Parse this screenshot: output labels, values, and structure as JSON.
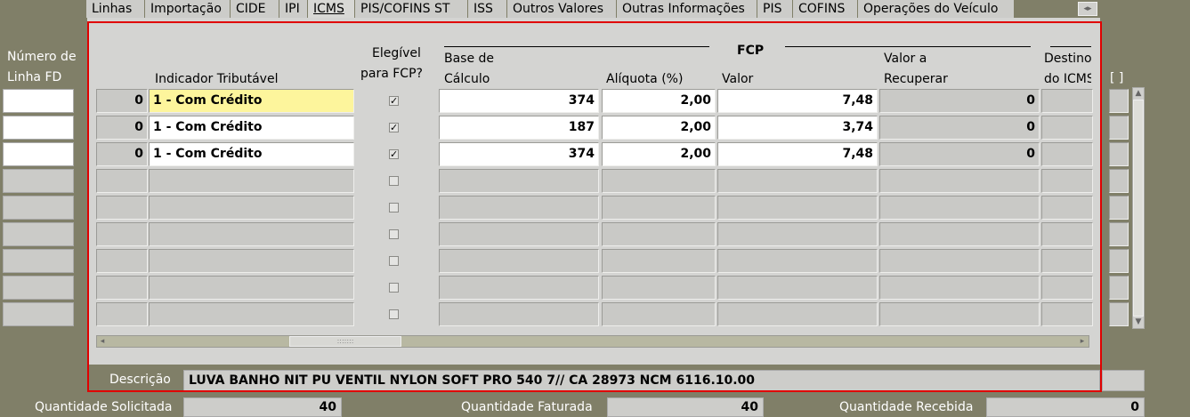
{
  "tabs": [
    {
      "label": "Linhas",
      "w": 66
    },
    {
      "label": "Importação",
      "w": 96
    },
    {
      "label": "CIDE",
      "w": 55
    },
    {
      "label": "IPI",
      "w": 32
    },
    {
      "label": "ICMS",
      "w": 53,
      "active": true
    },
    {
      "label": "PIS/COFINS ST",
      "w": 127
    },
    {
      "label": "ISS",
      "w": 44
    },
    {
      "label": "Outros Valores",
      "w": 123
    },
    {
      "label": "Outras Informações",
      "w": 158
    },
    {
      "label": "PIS",
      "w": 40
    },
    {
      "label": "COFINS",
      "w": 73
    },
    {
      "label": "Operações do Veículo",
      "w": 176
    }
  ],
  "left_header": {
    "line1": "Número de",
    "line2": "Linha FD"
  },
  "headers": {
    "indicador": "Indicador Tributável",
    "elegivel_1": "Elegível",
    "elegivel_2": "para FCP?",
    "fcp": "FCP",
    "base_1": "Base de",
    "base_2": "Cálculo",
    "aliquota": "Alíquota (%)",
    "valor": "Valor",
    "recuperar_1": "Valor a",
    "recuperar_2": "Recuperar",
    "destino_1": "Destino",
    "destino_2": "do ICMS",
    "brackets": "[ ]"
  },
  "rows": [
    {
      "num": "0",
      "indicador": "1 - Com Crédito",
      "checked": true,
      "base": "374",
      "aliquota": "2,00",
      "valor": "7,48",
      "recuperar": "0"
    },
    {
      "num": "0",
      "indicador": "1 - Com Crédito",
      "checked": true,
      "base": "187",
      "aliquota": "2,00",
      "valor": "3,74",
      "recuperar": "0"
    },
    {
      "num": "0",
      "indicador": "1 - Com Crédito",
      "checked": true,
      "base": "374",
      "aliquota": "2,00",
      "valor": "7,48",
      "recuperar": "0"
    },
    {
      "num": "",
      "indicador": "",
      "checked": false,
      "base": "",
      "aliquota": "",
      "valor": "",
      "recuperar": ""
    },
    {
      "num": "",
      "indicador": "",
      "checked": false,
      "base": "",
      "aliquota": "",
      "valor": "",
      "recuperar": ""
    },
    {
      "num": "",
      "indicador": "",
      "checked": false,
      "base": "",
      "aliquota": "",
      "valor": "",
      "recuperar": ""
    },
    {
      "num": "",
      "indicador": "",
      "checked": false,
      "base": "",
      "aliquota": "",
      "valor": "",
      "recuperar": ""
    },
    {
      "num": "",
      "indicador": "",
      "checked": false,
      "base": "",
      "aliquota": "",
      "valor": "",
      "recuperar": ""
    },
    {
      "num": "",
      "indicador": "",
      "checked": false,
      "base": "",
      "aliquota": "",
      "valor": "",
      "recuperar": ""
    }
  ],
  "descricao": {
    "label": "Descrição",
    "value": "LUVA BANHO NIT PU VENTIL NYLON SOFT PRO 540 7// CA 28973 NCM 6116.10.00"
  },
  "quantities": {
    "solicitada_label": "Quantidade Solicitada",
    "solicitada": "40",
    "faturada_label": "Quantidade Faturada",
    "faturada": "40",
    "recebida_label": "Quantidade Recebida",
    "recebida": "0"
  },
  "colors": {
    "background": "#807f68",
    "panel": "#d4d4d2",
    "highlight": "#fdf59c",
    "frame": "#e00000"
  }
}
